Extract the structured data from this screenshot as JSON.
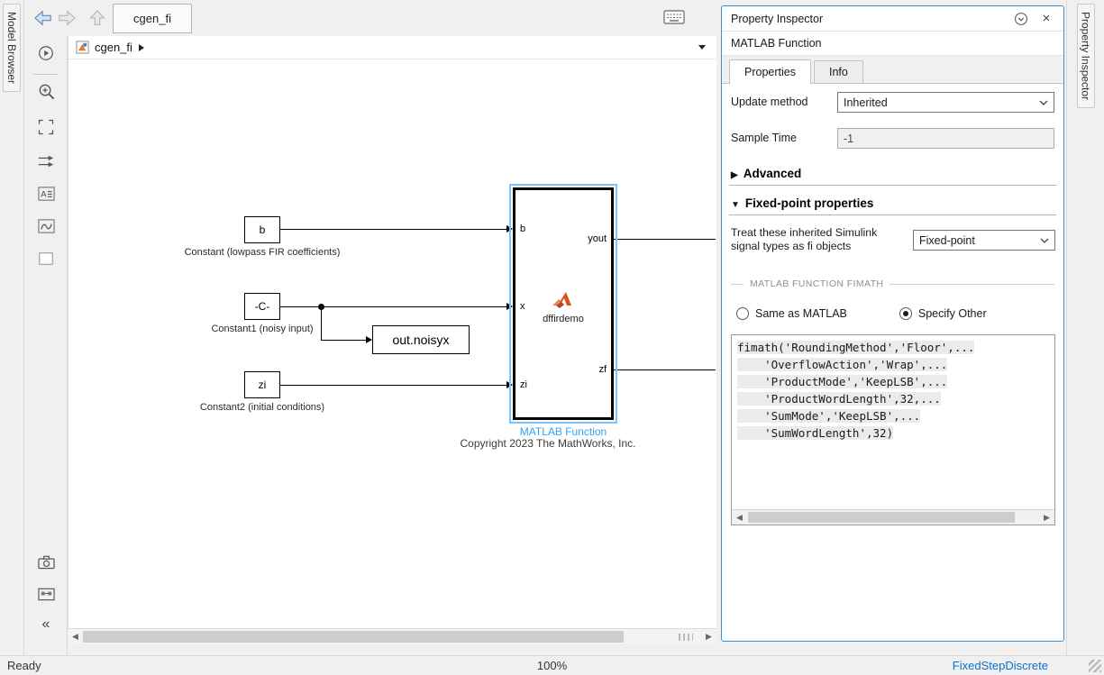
{
  "chrome": {
    "left_rail_label": "Model Browser",
    "right_rail_label": "Property Inspector",
    "doc_tab": "cgen_fi",
    "breadcrumb": "cgen_fi",
    "status": {
      "ready": "Ready",
      "zoom": "100%",
      "solver": "FixedStepDiscrete"
    }
  },
  "canvas": {
    "blocks": {
      "const_b": {
        "text": "b",
        "label": "Constant (lowpass FIR coefficients)"
      },
      "const_noisy": {
        "text": "-C-",
        "label": "Constant1 (noisy input)"
      },
      "const_zi": {
        "text": "zi",
        "label": "Constant2 (initial conditions)"
      },
      "to_workspace": {
        "text": "out.noisyx"
      },
      "matlab_function": {
        "name": "dffirdemo",
        "label": "MATLAB Function",
        "ports_in": [
          "b",
          "x",
          "zi"
        ],
        "ports_out": [
          "yout",
          "zf"
        ]
      }
    },
    "copyright": "Copyright 2023 The MathWorks, Inc."
  },
  "inspector": {
    "title": "Property Inspector",
    "subject": "MATLAB Function",
    "tabs": {
      "properties": "Properties",
      "info": "Info"
    },
    "update_method": {
      "label": "Update method",
      "value": "Inherited"
    },
    "sample_time": {
      "label": "Sample Time",
      "value": "-1"
    },
    "sections": {
      "advanced": "Advanced",
      "fixed_point": "Fixed-point properties"
    },
    "fi_objects": {
      "label_line1": "Treat these inherited Simulink",
      "label_line2": "signal types as fi objects",
      "value": "Fixed-point"
    },
    "fimath_group": "MATLAB FUNCTION FIMATH",
    "radios": {
      "same": "Same as MATLAB",
      "specify": "Specify Other"
    },
    "fimath_code": [
      "fimath('RoundingMethod','Floor',...",
      "    'OverflowAction','Wrap',...",
      "    'ProductMode','KeepLSB',...",
      "    'ProductWordLength',32,...",
      "    'SumMode','KeepLSB',...",
      "    'SumWordLength',32)"
    ]
  },
  "colors": {
    "selection_blue": "#7cc4ff",
    "block_label_blue": "#2fa3f7",
    "solver_link_blue": "#0b72c9",
    "matlab_orange": "#d95319"
  }
}
